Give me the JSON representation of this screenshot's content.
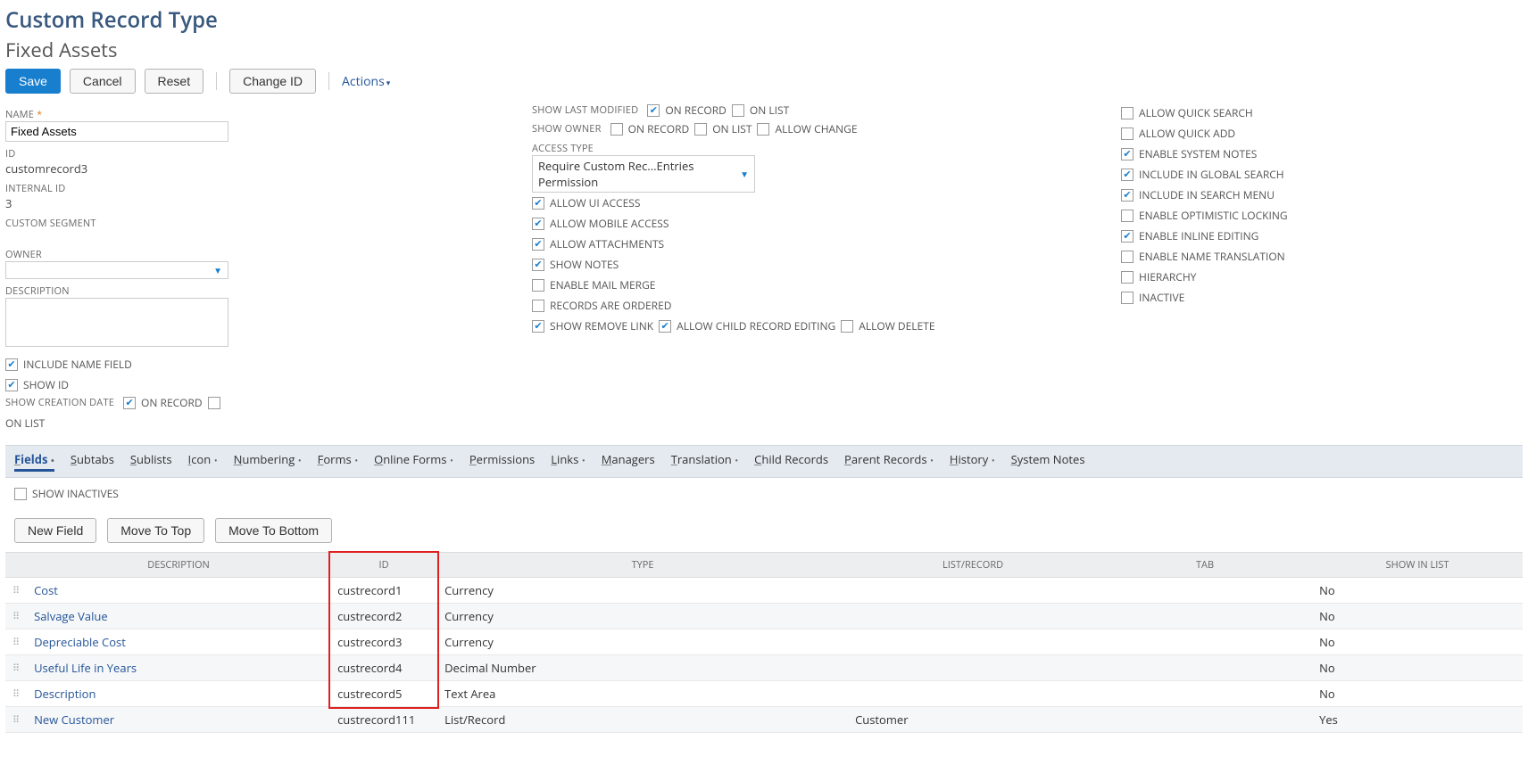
{
  "header": {
    "pageType": "Custom Record Type",
    "recordName": "Fixed Assets"
  },
  "toolbar": {
    "save": "Save",
    "cancel": "Cancel",
    "reset": "Reset",
    "changeId": "Change ID",
    "actions": "Actions"
  },
  "left": {
    "nameLabel": "NAME",
    "nameValue": "Fixed Assets",
    "idLabel": "ID",
    "idValue": "customrecord3",
    "internalIdLabel": "INTERNAL ID",
    "internalIdValue": "3",
    "customSegmentLabel": "CUSTOM SEGMENT",
    "ownerLabel": "OWNER",
    "ownerValue": "",
    "descriptionLabel": "DESCRIPTION",
    "includeNameField": "INCLUDE NAME FIELD",
    "showId": "SHOW ID",
    "showCreationDate": "SHOW CREATION DATE",
    "onRecord": "ON RECORD",
    "onList": "ON LIST"
  },
  "mid": {
    "showLastModified": "SHOW LAST MODIFIED",
    "onRecord": "ON RECORD",
    "onList": "ON LIST",
    "showOwner": "SHOW OWNER",
    "allowChange": "ALLOW CHANGE",
    "accessTypeLabel": "ACCESS TYPE",
    "accessTypeValue": "Require Custom Rec...Entries Permission",
    "allowUiAccess": "ALLOW UI ACCESS",
    "allowMobileAccess": "ALLOW MOBILE ACCESS",
    "allowAttachments": "ALLOW ATTACHMENTS",
    "showNotes": "SHOW NOTES",
    "enableMailMerge": "ENABLE MAIL MERGE",
    "recordsAreOrdered": "RECORDS ARE ORDERED",
    "showRemoveLink": "SHOW REMOVE LINK",
    "allowChildRecordEditing": "ALLOW CHILD RECORD EDITING",
    "allowDelete": "ALLOW DELETE"
  },
  "right": {
    "allowQuickSearch": "ALLOW QUICK SEARCH",
    "allowQuickAdd": "ALLOW QUICK ADD",
    "enableSystemNotes": "ENABLE SYSTEM NOTES",
    "includeInGlobalSearch": "INCLUDE IN GLOBAL SEARCH",
    "includeInSearchMenu": "INCLUDE IN SEARCH MENU",
    "enableOptimisticLocking": "ENABLE OPTIMISTIC LOCKING",
    "enableInlineEditing": "ENABLE INLINE EDITING",
    "enableNameTranslation": "ENABLE NAME TRANSLATION",
    "hierarchy": "HIERARCHY",
    "inactive": "INACTIVE"
  },
  "subtabs": [
    {
      "label": "Fields",
      "ul": "F",
      "active": true,
      "dot": true
    },
    {
      "label": "Subtabs",
      "ul": "S"
    },
    {
      "label": "Sublists",
      "ul": "S"
    },
    {
      "label": "Icon",
      "ul": "I",
      "dot": true
    },
    {
      "label": "Numbering",
      "ul": "N",
      "dot": true
    },
    {
      "label": "Forms",
      "ul": "F",
      "dot": true
    },
    {
      "label": "Online Forms",
      "ul": "O",
      "dot": true
    },
    {
      "label": "Permissions",
      "ul": "P"
    },
    {
      "label": "Links",
      "ul": "L",
      "dot": true
    },
    {
      "label": "Managers",
      "ul": "M"
    },
    {
      "label": "Translation",
      "ul": "T",
      "dot": true
    },
    {
      "label": "Child Records",
      "ul": "C"
    },
    {
      "label": "Parent Records",
      "ul": "P",
      "dot": true
    },
    {
      "label": "History",
      "ul": "H",
      "dot": true
    },
    {
      "label": "System Notes",
      "ul": "S"
    }
  ],
  "sublist": {
    "showInactives": "SHOW INACTIVES",
    "newField": "New Field",
    "moveToTop": "Move To Top",
    "moveToBottom": "Move To Bottom",
    "headers": {
      "description": "DESCRIPTION",
      "id": "ID",
      "type": "TYPE",
      "listRecord": "LIST/RECORD",
      "tab": "TAB",
      "showInList": "SHOW IN LIST"
    },
    "rows": [
      {
        "desc": "Cost",
        "id": "custrecord1",
        "type": "Currency",
        "lr": "",
        "tab": "",
        "show": "No"
      },
      {
        "desc": "Salvage Value",
        "id": "custrecord2",
        "type": "Currency",
        "lr": "",
        "tab": "",
        "show": "No"
      },
      {
        "desc": "Depreciable Cost",
        "id": "custrecord3",
        "type": "Currency",
        "lr": "",
        "tab": "",
        "show": "No"
      },
      {
        "desc": "Useful Life in Years",
        "id": "custrecord4",
        "type": "Decimal Number",
        "lr": "",
        "tab": "",
        "show": "No"
      },
      {
        "desc": "Description",
        "id": "custrecord5",
        "type": "Text Area",
        "lr": "",
        "tab": "",
        "show": "No"
      },
      {
        "desc": "New Customer",
        "id": "custrecord111",
        "type": "List/Record",
        "lr": "Customer",
        "tab": "",
        "show": "Yes"
      }
    ]
  }
}
